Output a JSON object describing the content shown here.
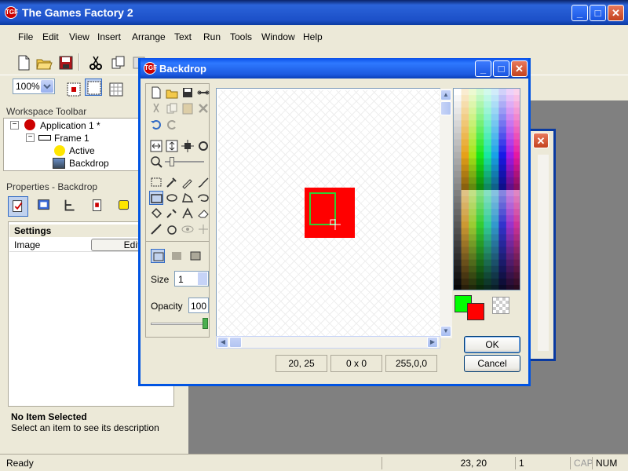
{
  "app": {
    "title": "The Games Factory 2",
    "icon": "TGF",
    "window_controls": {
      "minimize": "_",
      "maximize": "□",
      "close": "✕"
    }
  },
  "menu": [
    "File",
    "Edit",
    "View",
    "Insert",
    "Arrange",
    "Text",
    "Run",
    "Tools",
    "Window",
    "Help"
  ],
  "toolbar": {
    "icons": [
      "new-file-icon",
      "open-folder-icon",
      "save-disk-icon",
      "cut-icon",
      "copy-icon",
      "undo-icon"
    ],
    "zoom_value": "100%"
  },
  "workspace": {
    "header": "Workspace Toolbar",
    "tree": [
      {
        "label": "Application 1 *",
        "expander": "−"
      },
      {
        "label": "Frame 1",
        "expander": "−"
      },
      {
        "label": "Active"
      },
      {
        "label": "Backdrop"
      }
    ]
  },
  "properties": {
    "header": "Properties - Backdrop",
    "section": "Settings",
    "row_label": "Image",
    "row_button": "Edit",
    "desc_title": "No Item Selected",
    "desc_text": "Select an item to see its description"
  },
  "statusbar": {
    "status": "Ready",
    "coords": "23, 20",
    "frame": "1",
    "cap": "CAP",
    "num": "NUM"
  },
  "dialog": {
    "title": "Backdrop",
    "size_label": "Size",
    "size_value": "1",
    "opacity_label": "Opacity",
    "opacity_value": "100",
    "readout_pos": "20, 25",
    "readout_size": "0 x 0",
    "readout_color": "255,0,0",
    "ok_label": "OK",
    "cancel_label": "Cancel",
    "colors": {
      "foreground": "#00ff00",
      "background": "#ff0000",
      "shape_fill": "#ff0000",
      "selection_outline": "#33cc33"
    }
  }
}
